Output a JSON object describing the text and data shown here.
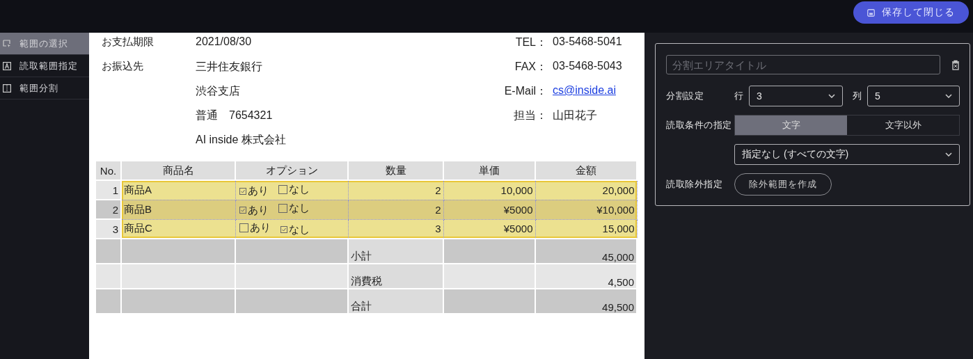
{
  "top_bar": {
    "save_button": "保存して閉じる"
  },
  "sidebar": {
    "items": [
      {
        "label": "範囲の選択",
        "kind": "select",
        "selected": true
      },
      {
        "label": "読取範囲指定",
        "kind": "text",
        "selected": false
      },
      {
        "label": "範囲分割",
        "kind": "split",
        "selected": false
      }
    ]
  },
  "document": {
    "info_left": [
      {
        "label": "お支払期限",
        "value": "2021/08/30"
      },
      {
        "label": "お振込先",
        "value": "三井住友銀行"
      },
      {
        "value": "渋谷支店"
      },
      {
        "value": "普通　7654321"
      },
      {
        "value": "AI inside 株式会社"
      }
    ],
    "info_right": [
      {
        "label": "TEL：",
        "value": "03-5468-5041",
        "kind": "text"
      },
      {
        "label": "FAX：",
        "value": "03-5468-5043",
        "kind": "text"
      },
      {
        "label": "E-Mail：",
        "value": "cs@inside.ai",
        "kind": "link"
      },
      {
        "label": "担当：",
        "value": "山田花子",
        "kind": "text"
      }
    ],
    "table": {
      "columns": [
        "No.",
        "商品名",
        "オプション",
        "数量",
        "単価",
        "金額"
      ],
      "rows": [
        {
          "no": "1",
          "name": "商品A",
          "options": [
            {
              "label": "あり",
              "checked": true
            },
            {
              "label": "なし",
              "checked": false
            }
          ],
          "quantity": "2",
          "unit_price": "10,000",
          "amount": "20,000",
          "in_area": true
        },
        {
          "no": "2",
          "name": "商品B",
          "options": [
            {
              "label": "あり",
              "checked": true
            },
            {
              "label": "なし",
              "checked": false
            }
          ],
          "quantity": "2",
          "unit_price": "¥5000",
          "amount": "¥10,000",
          "in_area": true
        },
        {
          "no": "3",
          "name": "商品C",
          "options": [
            {
              "label": "あり",
              "checked": false
            },
            {
              "label": "なし",
              "checked": true
            }
          ],
          "quantity": "3",
          "unit_price": "¥5000",
          "amount": "15,000",
          "in_area": true
        }
      ],
      "summary": [
        {
          "label": "小計",
          "value": "45,000"
        },
        {
          "label": "消費税",
          "value": "4,500"
        },
        {
          "label": "合計",
          "value": "49,500"
        }
      ]
    }
  },
  "panel": {
    "title_field": {
      "placeholder": "分割エリアタイトル"
    },
    "split": {
      "label": "分割設定",
      "rows_label": "行",
      "rows_value": "3",
      "cols_label": "列",
      "cols_value": "5"
    },
    "read_condition": {
      "label": "読取条件の指定",
      "options": [
        {
          "label": "文字",
          "selected": true
        },
        {
          "label": "文字以外",
          "selected": false
        }
      ],
      "filter": "指定なし (すべての文字)"
    },
    "exclusion": {
      "label": "読取除外指定",
      "button": "除外範囲を作成"
    }
  }
}
